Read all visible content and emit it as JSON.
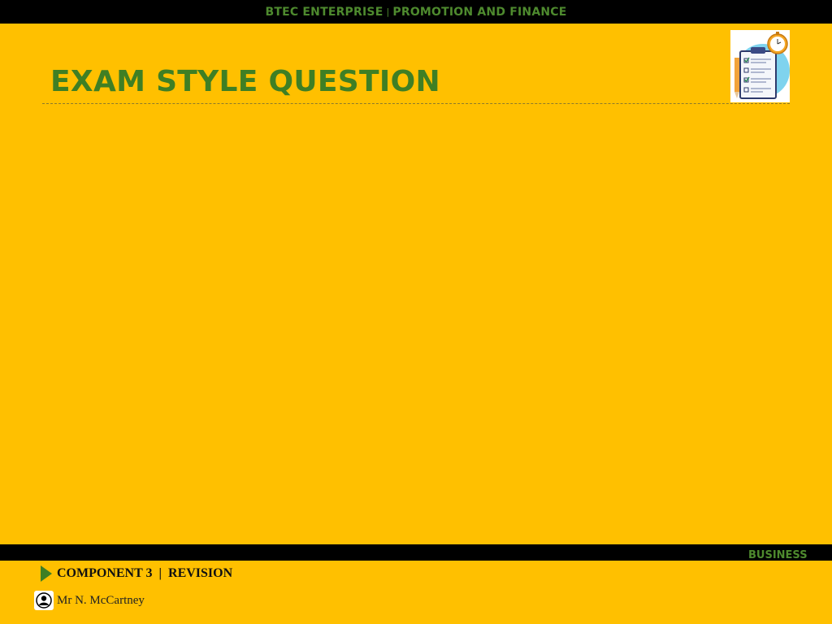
{
  "header": {
    "course": "BTEC ENTERPRISE",
    "separator": "|",
    "topic": "PROMOTION AND FINANCE"
  },
  "slide": {
    "title": "EXAM STYLE QUESTION"
  },
  "footer": {
    "subject": "BUSINESS",
    "component": "COMPONENT 3",
    "separator": "|",
    "section": "REVISION",
    "author": "Mr N. McCartney"
  },
  "colors": {
    "background": "#FFC000",
    "accent_green": "#3F7F24",
    "bar": "#000000"
  },
  "icons": {
    "header_image": "clipboard-checklist-stopwatch-icon",
    "component_marker": "play-arrow-icon",
    "author_marker": "user-icon"
  }
}
